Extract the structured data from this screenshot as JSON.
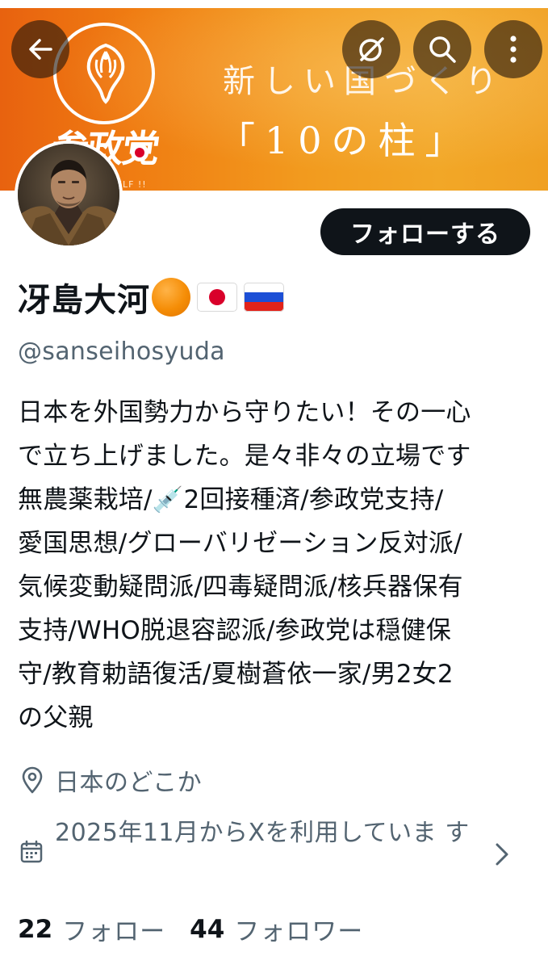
{
  "banner": {
    "party_logo_text": "参政党",
    "tagline": "ELF !!",
    "headline_1": "新しい国づくり",
    "headline_2": "「10の柱」",
    "color": "#f08a18"
  },
  "toolbar": {
    "back_icon": "arrow-left",
    "grok_icon": "grok-slash-circle",
    "search_icon": "magnifier",
    "more_icon": "vertical-dots"
  },
  "profile": {
    "follow_label": "フォローする",
    "display_name": "冴島大河",
    "badges": [
      "orange-circle",
      "japan-flag",
      "russia-flag"
    ],
    "handle": "@sanseihosyuda",
    "bio_lines": [
      "日本を外国勢力から守りたい！その一心",
      "で立ち上げました。是々非々の立場です",
      "無農薬栽培/💉2回接種済/参政党支持/",
      "愛国思想/グローバリゼーション反対派/",
      "気候変動疑問派/四毒疑問派/核兵器保有",
      "支持/WHO脱退容認派/参政党は穏健保",
      "守/教育勅語復活/夏樹蒼依一家/男2女2",
      "の父親"
    ],
    "location": "日本のどこか",
    "joined": "2025年11月からXを利用していま す",
    "following_count": "22",
    "following_label": "フォロー",
    "followers_count": "44",
    "followers_label": "フォロワー"
  }
}
